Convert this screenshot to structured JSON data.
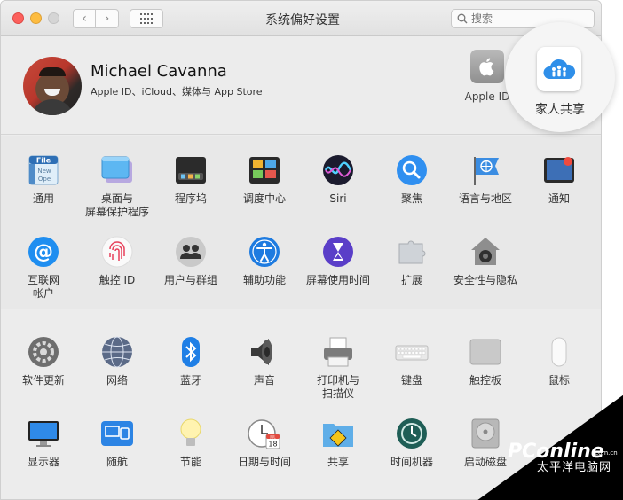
{
  "window": {
    "title": "系统偏好设置"
  },
  "search": {
    "placeholder": "搜索"
  },
  "user": {
    "name": "Michael Cavanna",
    "subtitle": "Apple ID、iCloud、媒体与 App Store"
  },
  "top_items": [
    {
      "label": "Apple ID",
      "icon": "apple-icon"
    },
    {
      "label": "家人共享",
      "icon": "family-sharing-icon"
    }
  ],
  "row1": [
    {
      "label": "通用",
      "icon": "general-icon"
    },
    {
      "label": "桌面与\n屏幕保护程序",
      "icon": "desktop-screensaver-icon"
    },
    {
      "label": "程序坞",
      "icon": "dock-icon"
    },
    {
      "label": "调度中心",
      "icon": "mission-control-icon"
    },
    {
      "label": "Siri",
      "icon": "siri-icon"
    },
    {
      "label": "聚焦",
      "icon": "spotlight-icon"
    },
    {
      "label": "语言与地区",
      "icon": "language-region-icon"
    },
    {
      "label": "通知",
      "icon": "notifications-icon"
    }
  ],
  "row2": [
    {
      "label": "互联网\n帐户",
      "icon": "internet-accounts-icon"
    },
    {
      "label": "触控 ID",
      "icon": "touch-id-icon"
    },
    {
      "label": "用户与群组",
      "icon": "users-groups-icon"
    },
    {
      "label": "辅助功能",
      "icon": "accessibility-icon"
    },
    {
      "label": "屏幕使用时间",
      "icon": "screen-time-icon"
    },
    {
      "label": "扩展",
      "icon": "extensions-icon"
    },
    {
      "label": "安全性与隐私",
      "icon": "security-privacy-icon"
    }
  ],
  "row3": [
    {
      "label": "软件更新",
      "icon": "software-update-icon"
    },
    {
      "label": "网络",
      "icon": "network-icon"
    },
    {
      "label": "蓝牙",
      "icon": "bluetooth-icon"
    },
    {
      "label": "声音",
      "icon": "sound-icon"
    },
    {
      "label": "打印机与\n扫描仪",
      "icon": "printer-icon"
    },
    {
      "label": "键盘",
      "icon": "keyboard-icon"
    },
    {
      "label": "触控板",
      "icon": "trackpad-icon"
    },
    {
      "label": "鼠标",
      "icon": "mouse-icon"
    }
  ],
  "row4": [
    {
      "label": "显示器",
      "icon": "display-icon"
    },
    {
      "label": "随航",
      "icon": "sidecar-icon"
    },
    {
      "label": "节能",
      "icon": "energy-saver-icon"
    },
    {
      "label": "日期与时间",
      "icon": "date-time-icon"
    },
    {
      "label": "共享",
      "icon": "sharing-icon"
    },
    {
      "label": "时间机器",
      "icon": "time-machine-icon"
    },
    {
      "label": "启动磁盘",
      "icon": "startup-disk-icon"
    }
  ],
  "calendar": {
    "month": "JUL",
    "day": "18"
  },
  "watermark": {
    "brand": "PConline",
    "subtitle": "太平洋电脑网",
    "domain": ".com.cn"
  }
}
